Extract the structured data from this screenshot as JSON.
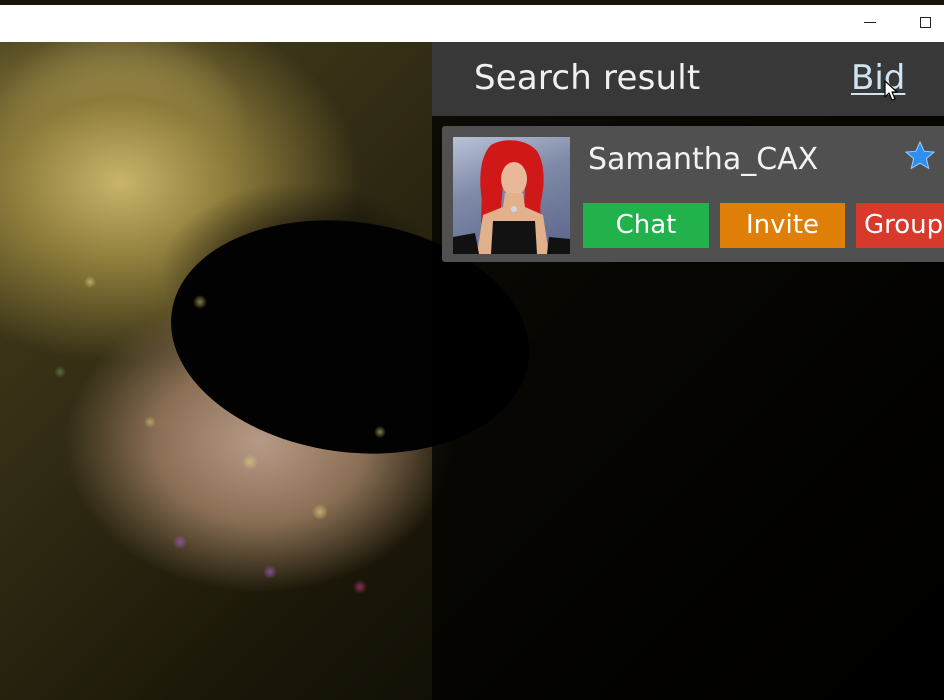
{
  "window": {
    "minimize_icon": "minimize-icon",
    "maximize_icon": "maximize-icon"
  },
  "panel": {
    "title": "Search result",
    "bid_link": "Bid"
  },
  "results": [
    {
      "username": "Samantha_CAX",
      "favorite_icon": "star-icon",
      "favorite_color": "#2f8ff0",
      "actions": {
        "chat": "Chat",
        "invite": "Invite",
        "group": "Group"
      }
    }
  ],
  "colors": {
    "panel_header": "#383838",
    "card": "#505050",
    "chat": "#22b24c",
    "invite": "#e07f08",
    "group": "#d8392b",
    "link": "#cfe6f2"
  }
}
